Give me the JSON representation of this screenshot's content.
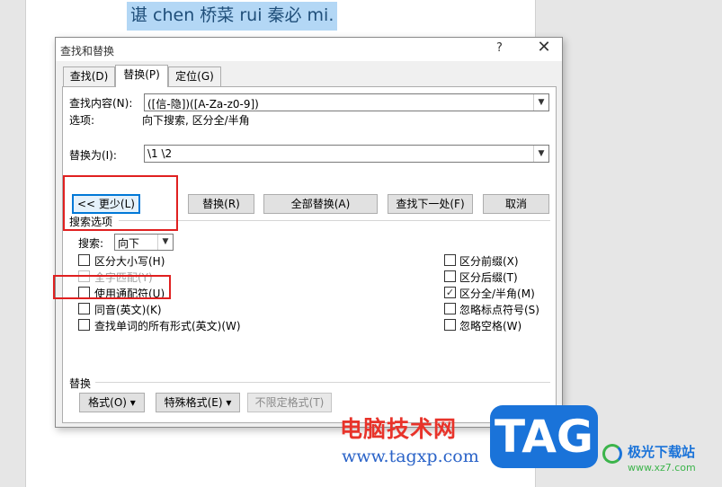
{
  "document": {
    "selected_text": "谌 chen 桥菜 rui 秦必 mi."
  },
  "dialog": {
    "title": "查找和替换",
    "help": "?",
    "close": "✕",
    "tabs": [
      {
        "label": "查找(D)"
      },
      {
        "label": "替换(P)"
      },
      {
        "label": "定位(G)"
      }
    ],
    "find": {
      "label": "查找内容(N):",
      "value": "([⁠信-隐])([A-Za-z0-9])",
      "options_label": "选项:",
      "options_value": "向下搜索, 区分全/半角"
    },
    "replace": {
      "label": "替换为(I):",
      "value": "\\1 \\2"
    },
    "buttons": {
      "less": "<< 更少(L)",
      "replace": "替换(R)",
      "replace_all": "全部替换(A)",
      "find_next": "查找下一处(F)",
      "cancel": "取消"
    },
    "search_options": {
      "heading": "搜索选项",
      "search_label": "搜索:",
      "search_value": "向下",
      "left_checks": [
        {
          "label": "区分大小写(H)",
          "checked": false,
          "disabled": false
        },
        {
          "label": "全字匹配(Y)",
          "checked": false,
          "disabled": true
        },
        {
          "label": "使用通配符(U)",
          "checked": false,
          "disabled": false
        },
        {
          "label": "同音(英文)(K)",
          "checked": false,
          "disabled": false
        },
        {
          "label": "查找单词的所有形式(英文)(W)",
          "checked": false,
          "disabled": false
        }
      ],
      "right_checks": [
        {
          "label": "区分前缀(X)",
          "checked": false
        },
        {
          "label": "区分后缀(T)",
          "checked": false
        },
        {
          "label": "区分全/半角(M)",
          "checked": true
        },
        {
          "label": "忽略标点符号(S)",
          "checked": false
        },
        {
          "label": "忽略空格(W)",
          "checked": false
        }
      ]
    },
    "replace_section": {
      "heading": "替换",
      "format": "格式(O) ▾",
      "special": "特殊格式(E) ▾",
      "no_format": "不限定格式(T)"
    }
  },
  "watermark": {
    "cn": "电脑技术网",
    "url": "www.tagxp.com",
    "logo": "TAG",
    "site_name": "极光下载站",
    "site_url": "www.xz7.com"
  },
  "colors": {
    "highlight_box": "#e02020",
    "selection": "#b3d7f5",
    "focus": "#0078d7"
  }
}
